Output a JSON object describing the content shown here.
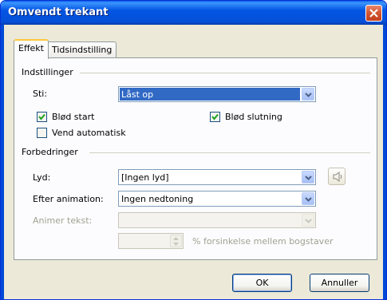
{
  "window": {
    "title": "Omvendt trekant"
  },
  "tabs": [
    {
      "label": "Effekt",
      "active": true
    },
    {
      "label": "Tidsindstilling",
      "active": false
    }
  ],
  "settings_group": {
    "label": "Indstillinger",
    "path_label": "Sti:",
    "path_value": "Låst op",
    "smooth_start": {
      "label": "Blød start",
      "checked": true
    },
    "smooth_end": {
      "label": "Blød slutning",
      "checked": true
    },
    "auto_reverse": {
      "label": "Vend automatisk",
      "checked": false
    }
  },
  "enhancements_group": {
    "label": "Forbedringer",
    "sound_label": "Lyd:",
    "sound_value": "[Ingen lyd]",
    "after_animation_label": "Efter animation:",
    "after_animation_value": "Ingen nedtoning",
    "animate_text_label": "Animer tekst:",
    "animate_text_value": "",
    "delay_value": "",
    "delay_label": "% forsinkelse mellem bogstaver"
  },
  "buttons": {
    "ok": "OK",
    "cancel": "Annuller"
  },
  "colors": {
    "title_bar": "#0355e3",
    "selection": "#316ac5",
    "dialog_bg": "#ece9d8",
    "close_button": "#d2542f"
  },
  "icons": {
    "close": "close-icon",
    "dropdown": "chevron-down-icon",
    "sound": "speaker-icon",
    "check": "checkmark-icon"
  }
}
